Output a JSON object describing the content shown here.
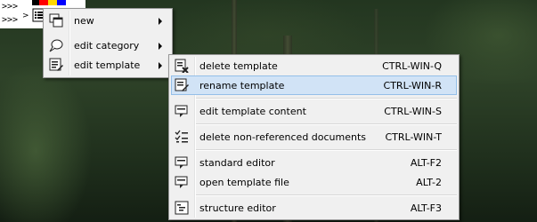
{
  "taskbar": {
    "row1": ">>>",
    "row2": ">>>",
    "colors": [
      "#000000",
      "#ff0000",
      "#ffd800",
      "#0000ff"
    ]
  },
  "main_menu": {
    "items": [
      {
        "label": "new",
        "icon": "window-icon"
      },
      {
        "label": "edit category",
        "icon": "speech-bubble-icon"
      },
      {
        "label": "edit template",
        "icon": "template-edit-icon"
      }
    ]
  },
  "submenu": {
    "items": [
      {
        "label": "delete template",
        "shortcut": "CTRL-WIN-Q",
        "icon": "delete-template-icon"
      },
      {
        "label": "rename template",
        "shortcut": "CTRL-WIN-R",
        "icon": "rename-template-icon"
      },
      {
        "label": "edit template content",
        "shortcut": "CTRL-WIN-S",
        "icon": "edit-content-icon"
      },
      {
        "label": "delete non-referenced documents",
        "shortcut": "CTRL-WIN-T",
        "icon": "checklist-icon"
      },
      {
        "label": "standard editor",
        "shortcut": "ALT-F2",
        "icon": "standard-editor-icon"
      },
      {
        "label": "open template file",
        "shortcut": "ALT-2",
        "icon": "open-file-icon"
      },
      {
        "label": "structure editor",
        "shortcut": "ALT-F3",
        "icon": "structure-editor-icon"
      }
    ]
  }
}
